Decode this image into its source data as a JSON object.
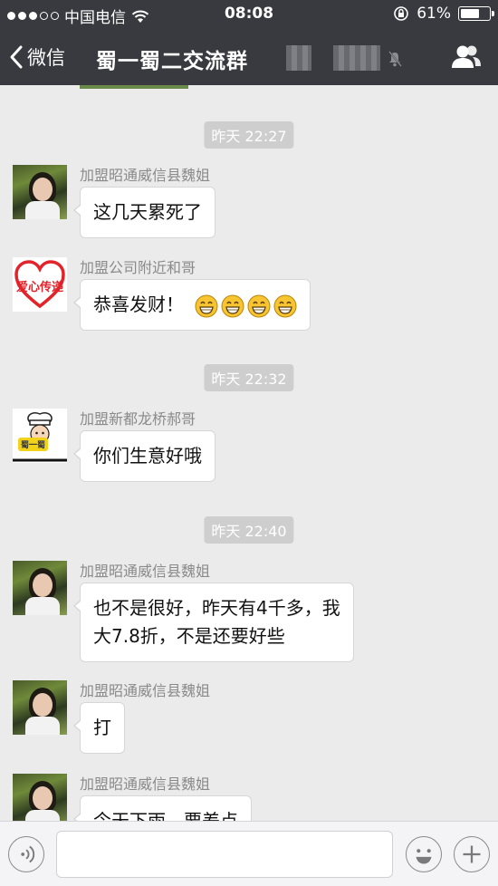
{
  "status_bar": {
    "carrier": "中国电信",
    "time": "08:08",
    "battery": "61%",
    "battery_level": 0.61,
    "icons": [
      "signal-dots-icon",
      "wifi-icon",
      "rotation-lock-icon",
      "battery-icon"
    ]
  },
  "nav": {
    "back_label": "微信",
    "title": "蜀一蜀二交流群",
    "icons": [
      "chevron-left-icon",
      "mute-icon",
      "group-members-icon"
    ]
  },
  "chat": {
    "items": [
      {
        "type": "time",
        "text": "昨天 22:27"
      },
      {
        "type": "msg",
        "sender": "加盟昭通威信县魏姐",
        "avatar": "photo",
        "text": "这几天累死了"
      },
      {
        "type": "msg",
        "sender": "加盟公司附近和哥",
        "avatar": "heart",
        "avatar_text": "爱心传递",
        "text": "恭喜发财！",
        "emoji": [
          "grin-emoji-icon",
          "grin-emoji-icon",
          "grin-emoji-icon",
          "grin-emoji-icon"
        ]
      },
      {
        "type": "time",
        "text": "昨天 22:32"
      },
      {
        "type": "msg",
        "sender": "加盟新都龙桥郝哥",
        "avatar": "chef",
        "avatar_text": "蜀一蜀",
        "text": "你们生意好哦"
      },
      {
        "type": "time",
        "text": "昨天 22:40"
      },
      {
        "type": "msg",
        "sender": "加盟昭通威信县魏姐",
        "avatar": "photo",
        "text_lines": [
          "也不是很好，昨天有4千多，我",
          "大7.8折，不是还要好些"
        ]
      },
      {
        "type": "msg",
        "sender": "加盟昭通威信县魏姐",
        "avatar": "photo",
        "text": "打"
      },
      {
        "type": "msg",
        "sender": "加盟昭通威信县魏姐",
        "avatar": "photo",
        "text": "今天下雨，要差点"
      }
    ]
  },
  "input_bar": {
    "placeholder": "",
    "icons": [
      "voice-icon",
      "emoji-icon",
      "plus-icon"
    ]
  },
  "colors": {
    "header_bg": "#383a3f",
    "chat_bg": "#ebebeb",
    "bubble_bg": "#ffffff",
    "timestamp_bg": "#cecece",
    "sender_text": "#8a8a8a"
  }
}
